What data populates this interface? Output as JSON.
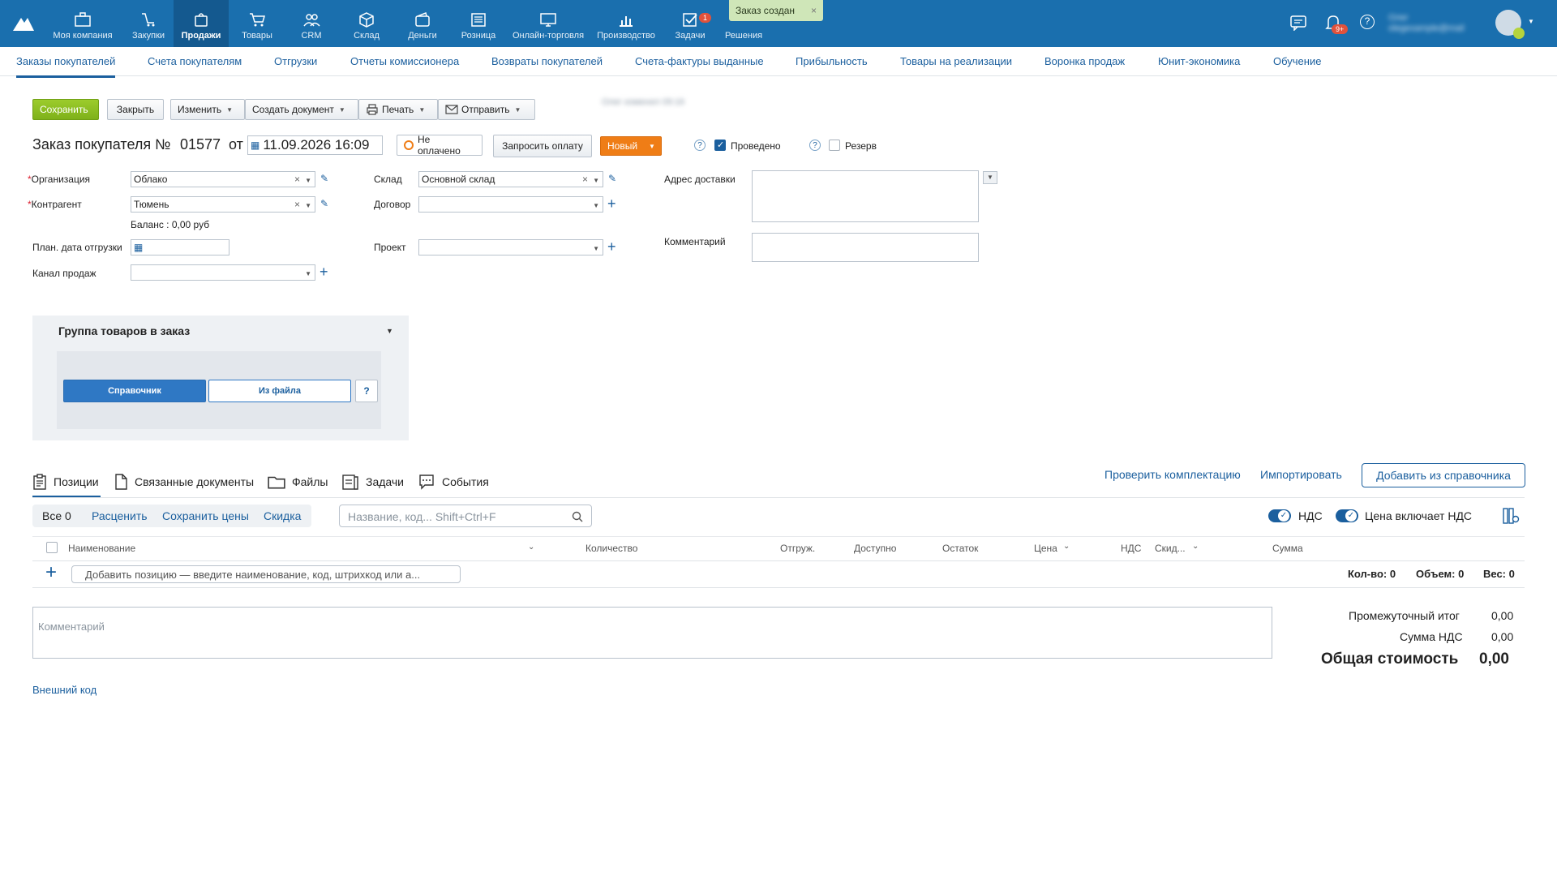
{
  "topnav": {
    "items": [
      {
        "label": "Моя компания",
        "icon": "company-icon"
      },
      {
        "label": "Закупки",
        "icon": "purchases-icon"
      },
      {
        "label": "Продажи",
        "icon": "sales-bag-icon"
      },
      {
        "label": "Товары",
        "icon": "cart-icon"
      },
      {
        "label": "CRM",
        "icon": "people-icon"
      },
      {
        "label": "Склад",
        "icon": "box-icon"
      },
      {
        "label": "Деньги",
        "icon": "wallet-icon"
      },
      {
        "label": "Розница",
        "icon": "register-icon"
      },
      {
        "label": "Онлайн-торговля",
        "icon": "online-shop-icon"
      },
      {
        "label": "Производство",
        "icon": "chart-icon"
      },
      {
        "label": "Задачи",
        "icon": "tasks-check-icon"
      },
      {
        "label": "Решения",
        "icon": "apps-icon"
      }
    ],
    "tasks_badge": "1",
    "notifications_badge": "9+",
    "user_blurred_text": "Олег\nolegexample@mail"
  },
  "toast": {
    "text": "Заказ создан",
    "close": "×"
  },
  "subnav": [
    "Заказы покупателей",
    "Счета покупателям",
    "Отгрузки",
    "Отчеты комиссионера",
    "Возвраты покупателей",
    "Счета-фактуры выданные",
    "Прибыльность",
    "Товары на реализации",
    "Воронка продаж",
    "Юнит-экономика",
    "Обучение"
  ],
  "toolbar": {
    "save": "Сохранить",
    "close": "Закрыть",
    "edit": "Изменить",
    "create_doc": "Создать документ",
    "print": "Печать",
    "send": "Отправить",
    "blurred_info": "Олег изменил 09:16"
  },
  "order": {
    "title": "Заказ покупателя №",
    "number": "01577",
    "from": "от",
    "datetime": "11.09.2026 16:09",
    "payment_status": "Не оплачено",
    "request_payment": "Запросить оплату",
    "state": "Новый",
    "posted_label": "Проведено",
    "reserve_label": "Резерв"
  },
  "form": {
    "org_label": "Организация",
    "org_value": "Облако",
    "contractor_label": "Контрагент",
    "contractor_value": "Тюмень",
    "balance": "Баланс : 0,00 руб",
    "ship_date_label": "План. дата отгрузки",
    "channel_label": "Канал продаж",
    "warehouse_label": "Склад",
    "warehouse_value": "Основной склад",
    "contract_label": "Договор",
    "project_label": "Проект",
    "address_label": "Адрес доставки",
    "comment_label": "Комментарий"
  },
  "group": {
    "title": "Группа товаров в заказ",
    "directory": "Справочник",
    "from_file": "Из файла",
    "help": "?"
  },
  "tabs": {
    "positions": "Позиции",
    "related": "Связанные документы",
    "files": "Файлы",
    "tasks": "Задачи",
    "events": "События",
    "check_set": "Проверить комплектацию",
    "import": "Импортировать",
    "add_from_dir": "Добавить из справочника"
  },
  "filters": {
    "all": "Все 0",
    "price": "Расценить",
    "save_prices": "Сохранить цены",
    "discount": "Скидка",
    "search_placeholder": "Название, код... Shift+Ctrl+F",
    "vat": "НДС",
    "price_incl_vat": "Цена включает НДС"
  },
  "table": {
    "headers": [
      "Наименование",
      "Количество",
      "Отгруж.",
      "Доступно",
      "Остаток",
      "Цена",
      "НДС",
      "Скид...",
      "Сумма"
    ],
    "add_placeholder": "Добавить позицию — введите наименование, код, штрихкод или а...",
    "qty": "Кол-во: 0",
    "volume": "Объем: 0",
    "weight": "Вес: 0"
  },
  "footer": {
    "comment_placeholder": "Комментарий",
    "subtotal_label": "Промежуточный итог",
    "subtotal": "0,00",
    "vat_sum_label": "Сумма НДС",
    "vat_sum": "0,00",
    "total_label": "Общая стоимость",
    "total": "0,00",
    "external_code": "Внешний код"
  },
  "colors": {
    "topbar": "#1a6fae",
    "link": "#1b5f9e",
    "save": "#8bbf22",
    "state": "#ef7d16"
  }
}
